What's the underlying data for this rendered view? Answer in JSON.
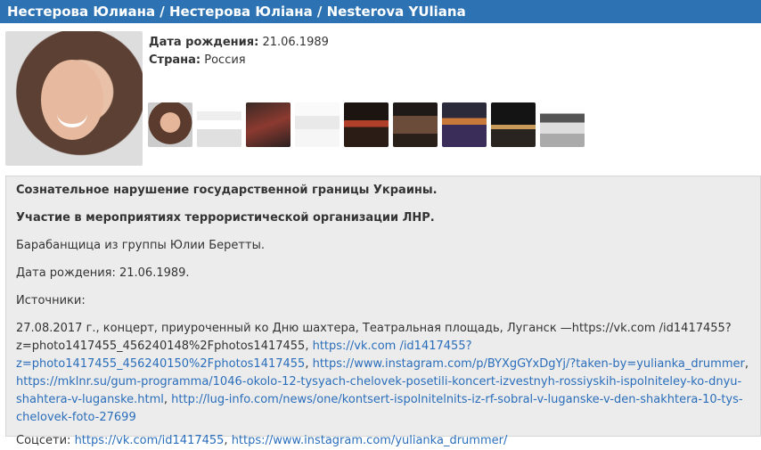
{
  "header": {
    "title": "Нестерова Юлиана / Нестерова Юліана / Nesterova YUliana"
  },
  "profile": {
    "birth_label": "Дата рождения:",
    "birth_value": "21.06.1989",
    "country_label": "Страна:",
    "country_value": "Россия"
  },
  "thumbnails": [
    "photo-1",
    "photo-2",
    "photo-3",
    "photo-4",
    "photo-5",
    "photo-6",
    "photo-7",
    "photo-8",
    "photo-9"
  ],
  "body": {
    "p1": "Сознательное нарушение государственной границы Украины.",
    "p2": "Участие в мероприятиях террористической организации ЛНР.",
    "p3": "Барабанщица из группы Юлии Беретты.",
    "p4": "Дата рождения: 21.06.1989.",
    "p5": "Источники:",
    "sources_intro": "27.08.2017 г., концерт, приуроченный ко Дню шахтера, Театральная площадь, Луганск —https://vk.com /id1417455?z=photo1417455_456240148%2Fphotos1417455, ",
    "link1": "https://vk.com /id1417455?z=photo1417455_456240150%2Fphotos1417455",
    "link2": "https://www.instagram.com/p/BYXgGYxDgYj/?taken-by=yulianka_drummer",
    "link3": "https://mklnr.su/gum-programma/1046-okolo-12-tysyach-chelovek-posetili-koncert-izvestnyh-rossiyskih-ispolniteley-ko-dnyu-shahtera-v-luganske.html",
    "link4": "http://lug-info.com/news/one/kontsert-ispolnitelnits-iz-rf-sobral-v-luganske-v-den-shakhtera-10-tys-chelovek-foto-27699",
    "social_label": "Соцсети: ",
    "social1": "https://vk.com/id1417455",
    "social2": "https://www.instagram.com/yulianka_drummer/"
  }
}
